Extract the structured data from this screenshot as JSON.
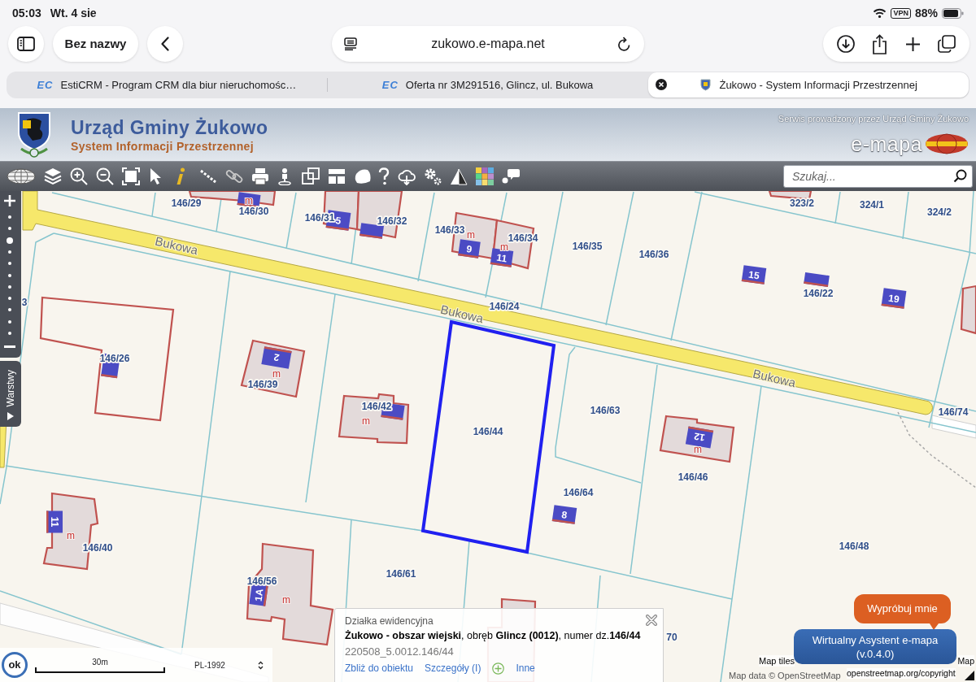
{
  "status_bar": {
    "time": "05:03",
    "date": "Wt. 4 sie",
    "vpn": "VPN",
    "battery": "88%"
  },
  "browser": {
    "tab_group": "Bez nazwy",
    "address": "zukowo.e-mapa.net",
    "tabs": [
      {
        "favicon": "EC",
        "title": "EstiCRM - Program CRM dla biur nieruchomośc…",
        "selected": false
      },
      {
        "favicon": "EC",
        "title": "Oferta nr 3M291516, Glincz, ul. Bukowa",
        "selected": false
      },
      {
        "title": "Żukowo - System Informacji Przestrzennej",
        "selected": true
      }
    ]
  },
  "header": {
    "title": "Urząd Gminy Żukowo",
    "subtitle": "System Informacji Przestrzennej",
    "note": "Serwis prowadzony przez Urząd Gminy Żukowo",
    "brand": "e-mapa"
  },
  "search": {
    "placeholder": "Szukaj..."
  },
  "map": {
    "zoom_slider": {
      "level": 0.8
    },
    "layers_tab": "Warstwy",
    "streets": [
      "Bukowa",
      "Bukowa",
      "Bukowa"
    ],
    "parcels": [
      {
        "label": "146/29",
        "selected": false
      },
      {
        "label": "146/30",
        "selected": false
      },
      {
        "label": "146/31",
        "selected": false
      },
      {
        "label": "146/32",
        "selected": false
      },
      {
        "label": "146/33",
        "selected": false
      },
      {
        "label": "146/34",
        "selected": false
      },
      {
        "label": "146/35",
        "selected": false
      },
      {
        "label": "146/36",
        "selected": false
      },
      {
        "label": "323/2",
        "selected": false
      },
      {
        "label": "324/1",
        "selected": false
      },
      {
        "label": "324/2",
        "selected": false
      },
      {
        "label": "146/22",
        "selected": false
      },
      {
        "label": "146/24",
        "selected": false
      },
      {
        "label": "3",
        "selected": false
      },
      {
        "label": "146/26",
        "selected": false
      },
      {
        "label": "146/39",
        "selected": false
      },
      {
        "label": "146/42",
        "selected": false
      },
      {
        "label": "146/44",
        "selected": true
      },
      {
        "label": "146/63",
        "selected": false
      },
      {
        "label": "146/74",
        "selected": false
      },
      {
        "label": "146/46",
        "selected": false
      },
      {
        "label": "146/64",
        "selected": false
      },
      {
        "label": "146/40",
        "selected": false
      },
      {
        "label": "146/56",
        "selected": false
      },
      {
        "label": "146/61",
        "selected": false
      },
      {
        "label": "146/48",
        "selected": false
      },
      {
        "label": "70",
        "selected": false
      }
    ],
    "house_numbers": [
      "5",
      "9",
      "11",
      "15",
      "19",
      "2",
      "12",
      "8",
      "11",
      "1A"
    ],
    "building_marks": [
      "m",
      "m",
      "m",
      "m",
      "m",
      "m",
      "m",
      "m"
    ],
    "scale": {
      "button": "ok",
      "distance": "30m",
      "projection": "PL-1992"
    },
    "attribution": {
      "tiles": "Map tiles",
      "tiles_end": "Map",
      "data": "Map data © OpenStreetMap",
      "link": "openstreetmap.org/copyright"
    }
  },
  "info_popup": {
    "heading": "Działka ewidencyjna",
    "description": "**Żukowo - obszar wiejski**, obręb **Glincz (0012)**, numer dz.**146/44**",
    "identifier": "220508_5.0012.146/44",
    "links": [
      "Zbliż do obiektu",
      "Szczegóły (I)",
      "Inne"
    ]
  },
  "assistant": {
    "prompt": "Wypróbuj mnie",
    "button": "Wirtualny Asystent e-mapa (v.0.4.0)"
  }
}
